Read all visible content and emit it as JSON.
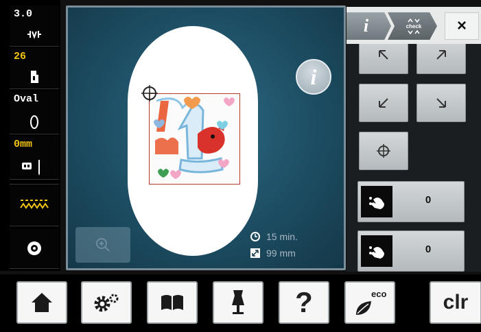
{
  "status_bar": {
    "stitch_width": {
      "value": "3.0",
      "icon": "stitch-width-icon"
    },
    "presser_foot": {
      "value": "26",
      "icon": "presser-foot-icon"
    },
    "hoop": {
      "value": "Oval",
      "icon": "oval-hoop-icon"
    },
    "needle": {
      "value": "0mm",
      "icon": "needle-icon"
    },
    "feed_dog": {
      "icon": "feed-dog-icon"
    },
    "bobbin": {
      "icon": "bobbin-icon"
    }
  },
  "main": {
    "design_text": "I am 1",
    "time": "15 min.",
    "size": "99 mm"
  },
  "right_panel": {
    "tab_info_label": "i",
    "tab_check_label": "check",
    "close_label": "×",
    "counters": [
      {
        "value": "0"
      },
      {
        "value": "0"
      }
    ]
  },
  "toolbar": {
    "eco_label": "eco",
    "help_label": "?",
    "clr_label": "clr"
  },
  "colors": {
    "panel_bg": "#1d4d63",
    "accent_yellow": "#f2c413",
    "frame_red": "#b33a2a"
  }
}
